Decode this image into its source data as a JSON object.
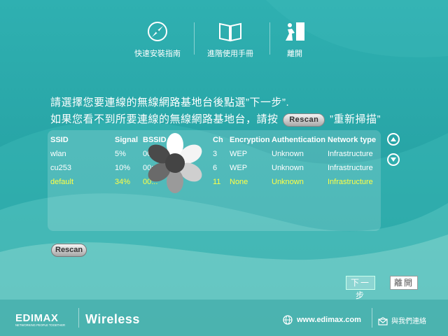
{
  "nav": {
    "items": [
      {
        "label": "快速安裝指南",
        "icon": "compass-icon"
      },
      {
        "label": "進階使用手冊",
        "icon": "book-icon"
      },
      {
        "label": "離開",
        "icon": "exit-door-icon"
      }
    ]
  },
  "instructions": {
    "line1": "請選擇您要連線的無線網路基地台後點選”下一步”.",
    "line2_pre": "如果您看不到所要連線的無線網路基地台，請按",
    "line2_button": "Rescan",
    "line2_post": "”重新掃描”"
  },
  "table": {
    "headers": [
      "SSID",
      "Signal",
      "BSSID",
      "Ch",
      "Encryption",
      "Authentication",
      "Network type"
    ],
    "rows": [
      [
        "wlan",
        "5%",
        "00:0E...05:96",
        "3",
        "WEP",
        "Unknown",
        "Infrastructure"
      ],
      [
        "cu253",
        "10%",
        "00:0...7A",
        "6",
        "WEP",
        "Unknown",
        "Infrastructure"
      ],
      [
        "default",
        "34%",
        "00...",
        "11",
        "None",
        "Unknown",
        "Infrastructure"
      ]
    ],
    "selected_row": 2
  },
  "buttons": {
    "rescan": "Rescan",
    "next": "下一步",
    "exit": "離開"
  },
  "footer": {
    "brand": "EDIMAX",
    "tagline": "NETWORKING PEOPLE TOGETHER",
    "product": "Wireless",
    "website": "www.edimax.com",
    "contact": "與我們連絡"
  },
  "colors": {
    "background": "#2aa5a7",
    "selected_row_text": "#ffff44",
    "text": "#ffffff"
  }
}
